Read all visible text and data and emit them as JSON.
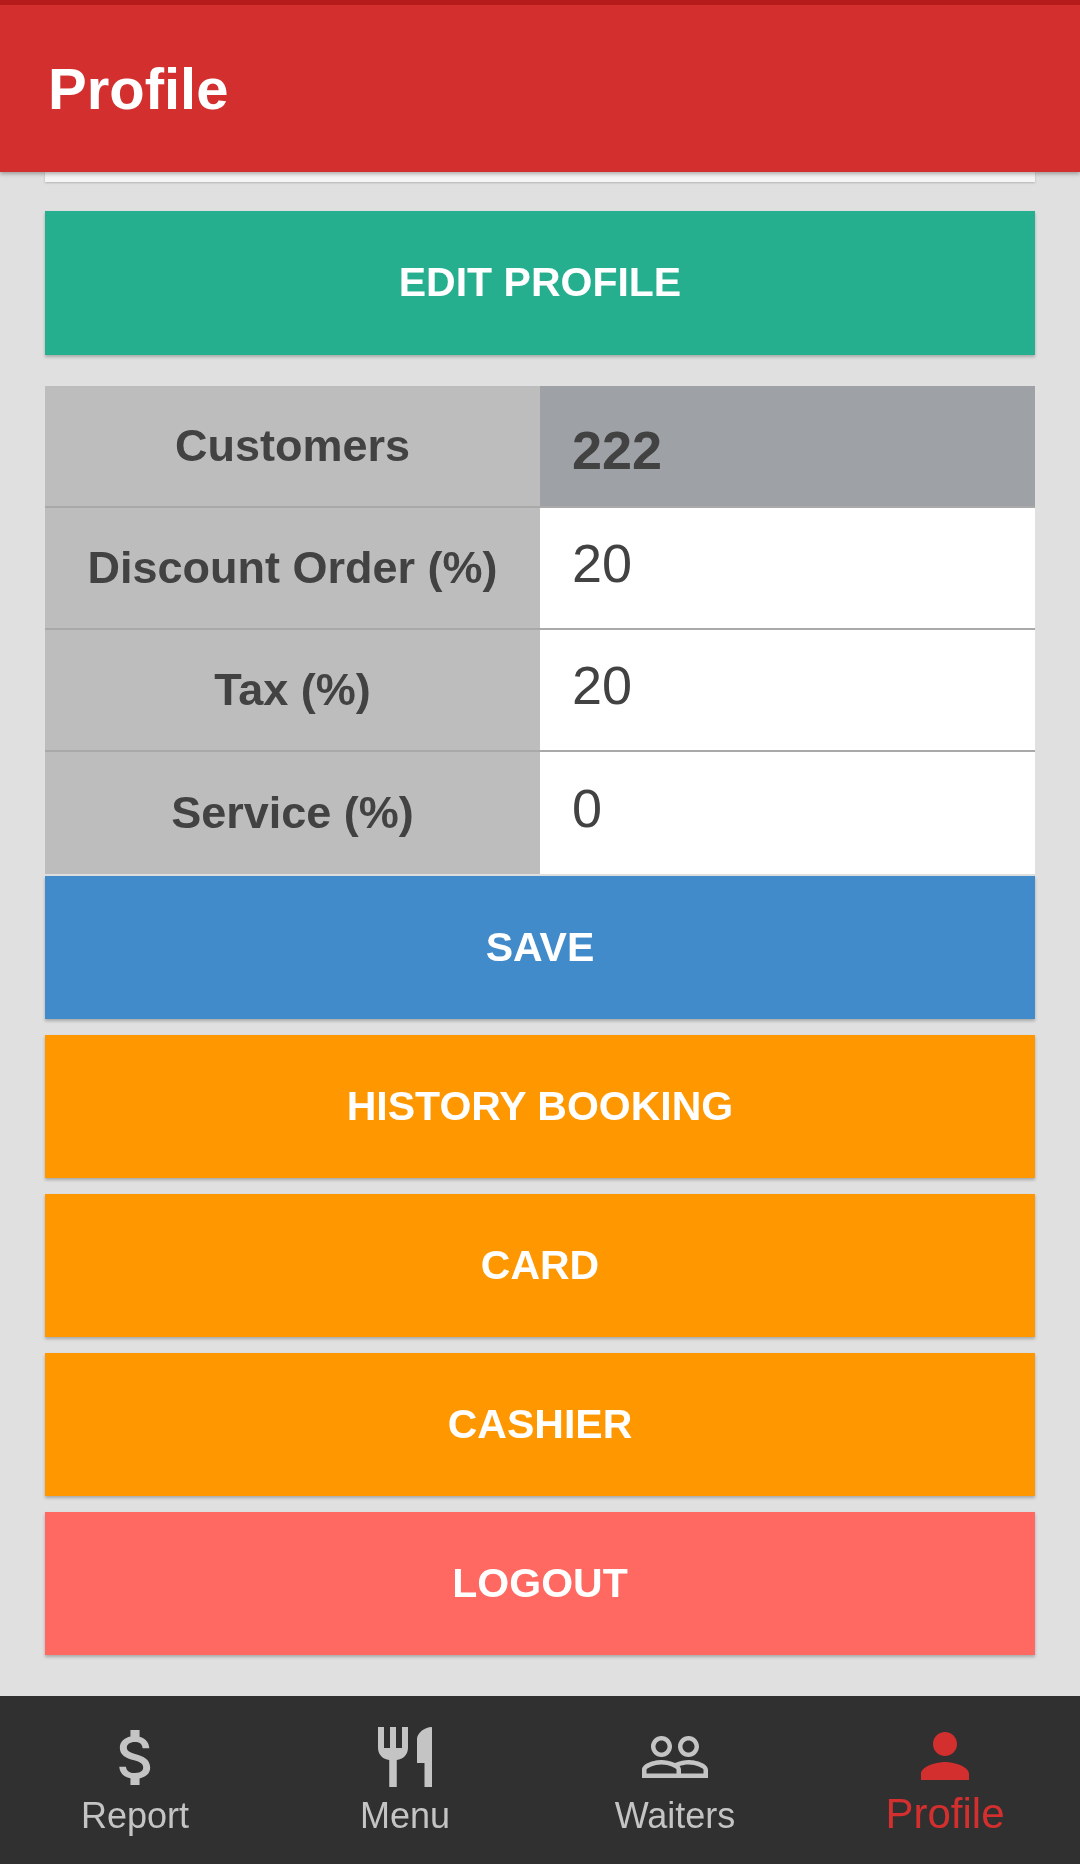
{
  "app_bar": {
    "title": "Profile"
  },
  "edit_profile_button": {
    "label": "EDIT PROFILE"
  },
  "settings_table": {
    "rows": [
      {
        "label": "Customers",
        "value": "222",
        "kind": "readonly"
      },
      {
        "label": "Discount Order (%)",
        "value": "20",
        "kind": "input"
      },
      {
        "label": "Tax (%)",
        "value": "20",
        "kind": "input"
      },
      {
        "label": "Service (%)",
        "value": "0",
        "kind": "input"
      }
    ]
  },
  "action_buttons": [
    {
      "label": "SAVE",
      "color": "#428bca"
    },
    {
      "label": "HISTORY BOOKING",
      "color": "#ff9800"
    },
    {
      "label": "CARD",
      "color": "#ff9800"
    },
    {
      "label": "CASHIER",
      "color": "#ff9800"
    },
    {
      "label": "LOGOUT",
      "color": "#ff6961"
    }
  ],
  "bottom_nav": [
    {
      "label": "Report",
      "selected": false
    },
    {
      "label": "Menu",
      "selected": false
    },
    {
      "label": "Waiters",
      "selected": false
    },
    {
      "label": "Profile",
      "selected": true
    }
  ]
}
